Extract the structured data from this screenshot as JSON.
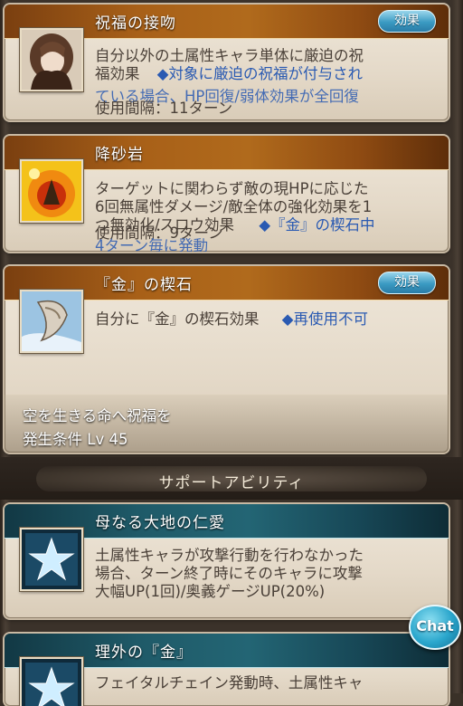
{
  "skills": [
    {
      "title": "祝福の接吻",
      "effect_button": "効果",
      "desc_line1": "自分以外の土属性キャラ単体に厳迫の祝",
      "desc_line2": "福効果",
      "desc_note": "◆対象に厳迫の祝福が付与され",
      "desc_line3_behind": "ている場合、HP回復/弱体効果が全回復",
      "cooldown": "使用間隔：11ターン"
    },
    {
      "title": "降砂岩",
      "desc_line1": "ターゲットに関わらず敵の現HPに応じた",
      "desc_line2": "6回無属性ダメージ/敵全体の強化効果を1",
      "desc_line3": "つ無効化/スロウ効果",
      "desc_note": "◆『金』の楔石中",
      "desc_line4_behind": "4ターン毎に発動",
      "cooldown": "使用間隔：9ターン"
    },
    {
      "title": "『金』の楔石",
      "effect_button": "効果",
      "desc_line1": "自分に『金』の楔石効果",
      "desc_note": "◆再使用不可",
      "condition_line1": "空を生きる命へ祝福を",
      "condition_line2": "発生条件 Lv 45"
    }
  ],
  "support_section": {
    "label": "サポートアビリティ"
  },
  "support": [
    {
      "title": "母なる大地の仁愛",
      "desc_line1": "土属性キャラが攻撃行動を行わなかった",
      "desc_line2": "場合、ターン終了時にそのキャラに攻撃",
      "desc_line3": "大幅UP(1回)/奥義ゲージUP(20%)"
    },
    {
      "title": "理外の『金』",
      "desc_line1": "フェイタルチェイン発動時、土属性キャ"
    }
  ],
  "chat": {
    "label": "Chat"
  }
}
